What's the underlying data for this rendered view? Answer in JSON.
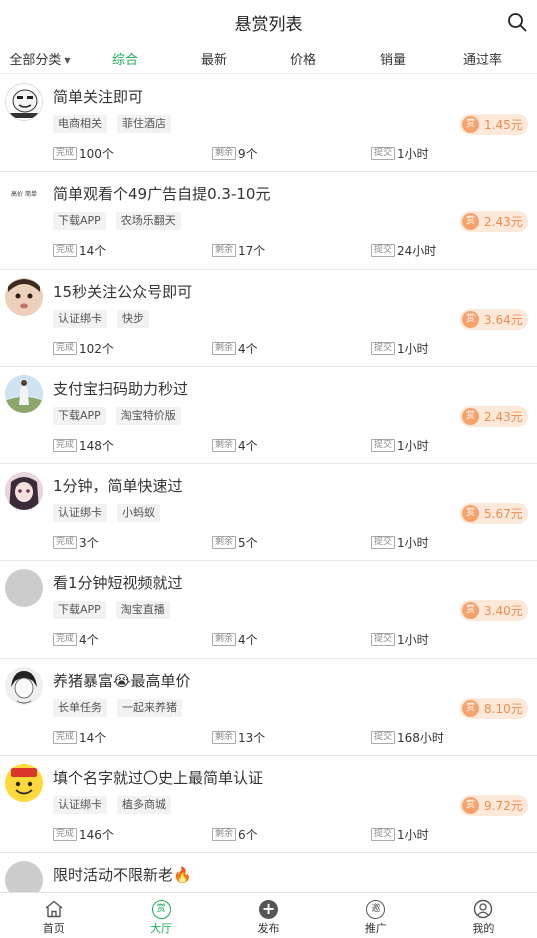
{
  "header": {
    "title": "悬赏列表"
  },
  "filters": [
    {
      "label": "全部分类",
      "active": false
    },
    {
      "label": "综合",
      "active": true
    },
    {
      "label": "最新",
      "active": false
    },
    {
      "label": "价格",
      "active": false
    },
    {
      "label": "销量",
      "active": false
    },
    {
      "label": "通过率",
      "active": false
    }
  ],
  "meta_labels": {
    "done": "完成",
    "remain": "剩余",
    "submit": "提交"
  },
  "price_icon": "赏",
  "tasks": [
    {
      "title": "简单关注即可",
      "tags": [
        "电商相关",
        "菲住酒店"
      ],
      "done": "100个",
      "remain": "9个",
      "submit": "1小时",
      "price": "1.45元"
    },
    {
      "title": "简单观看个49广告自提0.3-10元",
      "tags": [
        "下载APP",
        "农场乐翻天"
      ],
      "done": "14个",
      "remain": "17个",
      "submit": "24小时",
      "price": "2.43元",
      "avatar_text": "高价 简单"
    },
    {
      "title": "15秒关注公众号即可",
      "tags": [
        "认证绑卡",
        "快步"
      ],
      "done": "102个",
      "remain": "4个",
      "submit": "1小时",
      "price": "3.64元"
    },
    {
      "title": "支付宝扫码助力秒过",
      "tags": [
        "下载APP",
        "淘宝特价版"
      ],
      "done": "148个",
      "remain": "4个",
      "submit": "1小时",
      "price": "2.43元"
    },
    {
      "title": "1分钟，简单快速过",
      "tags": [
        "认证绑卡",
        "小蚂蚁"
      ],
      "done": "3个",
      "remain": "5个",
      "submit": "1小时",
      "price": "5.67元"
    },
    {
      "title": "看1分钟短视频就过",
      "tags": [
        "下载APP",
        "淘宝直播"
      ],
      "done": "4个",
      "remain": "4个",
      "submit": "1小时",
      "price": "3.40元"
    },
    {
      "title": "养猪暴富😭最高单价",
      "tags": [
        "长单任务",
        "一起来养猪"
      ],
      "done": "14个",
      "remain": "13个",
      "submit": "168小时",
      "price": "8.10元"
    },
    {
      "title": "填个名字就过〇史上最简单认证",
      "tags": [
        "认证绑卡",
        "植多商城"
      ],
      "done": "146个",
      "remain": "6个",
      "submit": "1小时",
      "price": "9.72元"
    },
    {
      "title": "限时活动不限新老🔥",
      "tags": [],
      "done": "",
      "remain": "",
      "submit": "",
      "price": ""
    }
  ],
  "tabbar": [
    {
      "label": "首页",
      "icon": "home-icon",
      "active": false
    },
    {
      "label": "大厅",
      "icon": "hall-icon",
      "active": true,
      "glyph": "赏"
    },
    {
      "label": "发布",
      "icon": "publish-icon",
      "active": false,
      "glyph": "+"
    },
    {
      "label": "推广",
      "icon": "promote-icon",
      "active": false,
      "glyph": "邀"
    },
    {
      "label": "我的",
      "icon": "profile-icon",
      "active": false
    }
  ],
  "colors": {
    "accent": "#1aad5a",
    "price": "#f08a4b",
    "price_bg": "#fde9d9"
  }
}
